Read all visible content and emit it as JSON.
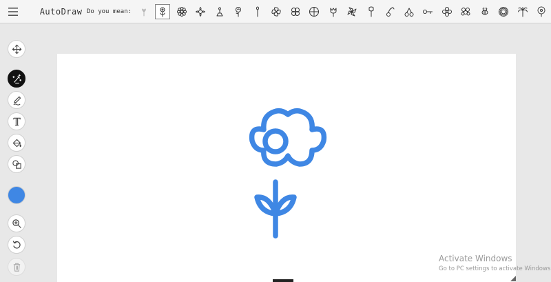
{
  "header": {
    "menu_icon": "hamburger-icon",
    "title": "AutoDraw",
    "suggestions_label": "Do you mean:",
    "suggestions": [
      {
        "icon": "sketch-flower-icon",
        "state": "faded"
      },
      {
        "icon": "simple-flower-icon",
        "state": "selected"
      },
      {
        "icon": "daisy-icon"
      },
      {
        "icon": "daisy-outline-icon"
      },
      {
        "icon": "flower-pot-icon"
      },
      {
        "icon": "rose-icon"
      },
      {
        "icon": "stem-icon"
      },
      {
        "icon": "pinwheel-icon"
      },
      {
        "icon": "clover-icon"
      },
      {
        "icon": "quad-circle-icon"
      },
      {
        "icon": "tulip-icon"
      },
      {
        "icon": "pinwheel-flower-icon"
      },
      {
        "icon": "bell-flower-icon"
      },
      {
        "icon": "cherry-icon"
      },
      {
        "icon": "cherries-icon"
      },
      {
        "icon": "key-icon"
      },
      {
        "icon": "four-petal-icon"
      },
      {
        "icon": "bouquet-icon"
      },
      {
        "icon": "bee-icon"
      },
      {
        "icon": "sunflower-icon"
      },
      {
        "icon": "palm-icon"
      },
      {
        "icon": "dandelion-icon"
      }
    ]
  },
  "tools": [
    {
      "name": "move-tool",
      "icon": "move-icon",
      "state": "normal"
    },
    {
      "name": "autodraw-tool",
      "icon": "autodraw-sparkle-icon",
      "state": "active"
    },
    {
      "name": "draw-tool",
      "icon": "pencil-icon",
      "state": "normal"
    },
    {
      "name": "type-tool",
      "icon": "text-icon",
      "state": "normal"
    },
    {
      "name": "fill-tool",
      "icon": "paint-bucket-icon",
      "state": "normal"
    },
    {
      "name": "shape-tool",
      "icon": "shapes-icon",
      "state": "normal"
    },
    {
      "name": "zoom-tool",
      "icon": "zoom-in-icon",
      "state": "normal"
    },
    {
      "name": "undo-tool",
      "icon": "undo-icon",
      "state": "normal"
    },
    {
      "name": "delete-tool",
      "icon": "trash-icon",
      "state": "disabled"
    }
  ],
  "colors": {
    "selected_color": "#3f87e4",
    "stroke": "#3f87e4",
    "toolbar_bg": "#f5f5f5",
    "workspace_bg": "#e8e8e8"
  },
  "canvas": {
    "drawing_icon": "simple-flower-drawing"
  },
  "watermark": {
    "title": "Activate Windows",
    "subtitle": "Go to PC settings to activate Windows."
  }
}
